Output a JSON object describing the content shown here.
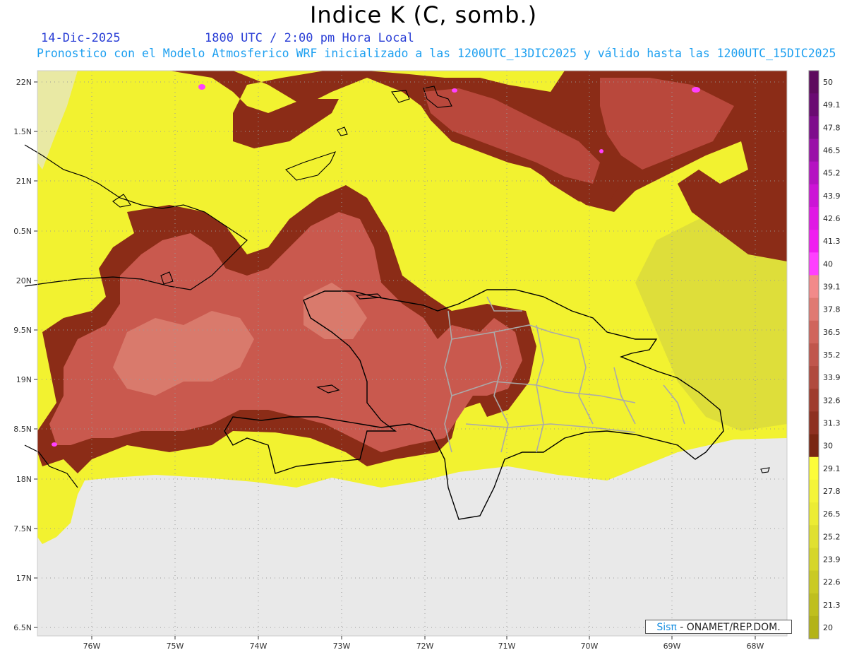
{
  "header": {
    "title": "Indice K (C, somb.)",
    "date": "14-Dic-2025",
    "time": "1800 UTC / 2:00 pm Hora Local",
    "subtitle": "Pronostico con el Modelo Atmosferico WRF inicializado a las 1200UTC_13DIC2025 y válido hasta las  1200UTC_15DIC2025"
  },
  "map": {
    "lat_labels": [
      "22N",
      "1.5N",
      "21N",
      "0.5N",
      "20N",
      "9.5N",
      "19N",
      "8.5N",
      "18N",
      "7.5N",
      "17N",
      "6.5N"
    ],
    "lon_labels": [
      "76W",
      "75W",
      "74W",
      "73W",
      "72W",
      "71W",
      "70W",
      "69W",
      "68W"
    ]
  },
  "colorbar": {
    "labels": [
      "50",
      "49.1",
      "47.8",
      "46.5",
      "45.2",
      "43.9",
      "42.6",
      "41.3",
      "40",
      "39.1",
      "37.8",
      "36.5",
      "35.2",
      "33.9",
      "32.6",
      "31.3",
      "30",
      "29.1",
      "27.8",
      "26.5",
      "25.2",
      "23.9",
      "22.6",
      "21.3",
      "20"
    ],
    "colors": [
      "#5e0a5e",
      "#6a0a72",
      "#7e0b8c",
      "#9a10a8",
      "#b512c2",
      "#cc14d6",
      "#e018e4",
      "#f01cf0",
      "#ff40ff",
      "#f28a8a",
      "#e07a72",
      "#d0655c",
      "#c0564c",
      "#b04a3e",
      "#9f3c2e",
      "#8e3020",
      "#7a2612",
      "#fcfc3a",
      "#f4f438",
      "#ecec34",
      "#e0e030",
      "#d6d62a",
      "#caca24",
      "#bfbf1e",
      "#b3b318"
    ]
  },
  "credit": {
    "brand": "Sisπ",
    "text": " - ONAMET/REP.DOM."
  }
}
